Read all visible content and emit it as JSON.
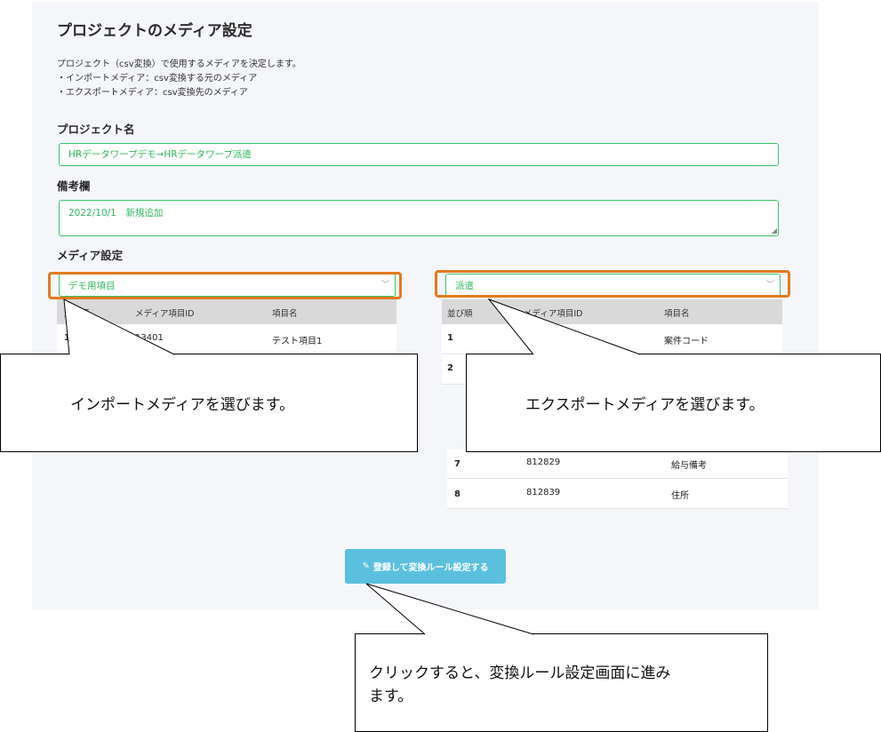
{
  "page": {
    "title": "プロジェクトのメディア設定",
    "description": [
      "プロジェクト（csv変換）で使用するメディアを決定します。",
      "・インポートメディア：csv変換する元のメディア",
      "・エクスポートメディア：csv変換先のメディア"
    ]
  },
  "form": {
    "project_name_label": "プロジェクト名",
    "project_name_value": "HRデータワープデモ→HRデータワープ派遣",
    "remarks_label": "備考欄",
    "remarks_value": "2022/10/1　新規追加",
    "media_label": "メディア設定"
  },
  "import": {
    "selected": "デモ用項目",
    "columns": [
      "並び順",
      "メディア項目ID",
      "項目名"
    ],
    "rows": [
      {
        "no": "1",
        "id": "13401",
        "name": "テスト項目1"
      }
    ]
  },
  "export": {
    "selected": "派遣",
    "columns": [
      "並び順",
      "メディア項目ID",
      "項目名"
    ],
    "rows": [
      {
        "no": "1",
        "id": "",
        "name": "案件コード"
      },
      {
        "no": "2",
        "id": "",
        "name": ""
      },
      {
        "no": "7",
        "id": "812829",
        "name": "給与備考"
      },
      {
        "no": "8",
        "id": "812839",
        "name": "住所"
      }
    ]
  },
  "actions": {
    "submit_label": "登録して変換ルール設定する",
    "submit_icon": "pencil-icon"
  },
  "callouts": {
    "import_text": "インポートメディアを選びます。",
    "export_text": "エクスポートメディアを選びます。",
    "button_text_line1": "クリックすると、変換ルール設定画面に進み",
    "button_text_line2": "ます。"
  },
  "colors": {
    "accent_green": "#2eb85c",
    "highlight_orange": "#e37a1e",
    "button_blue": "#5bc0de",
    "panel_bg": "#f4f6fa"
  }
}
